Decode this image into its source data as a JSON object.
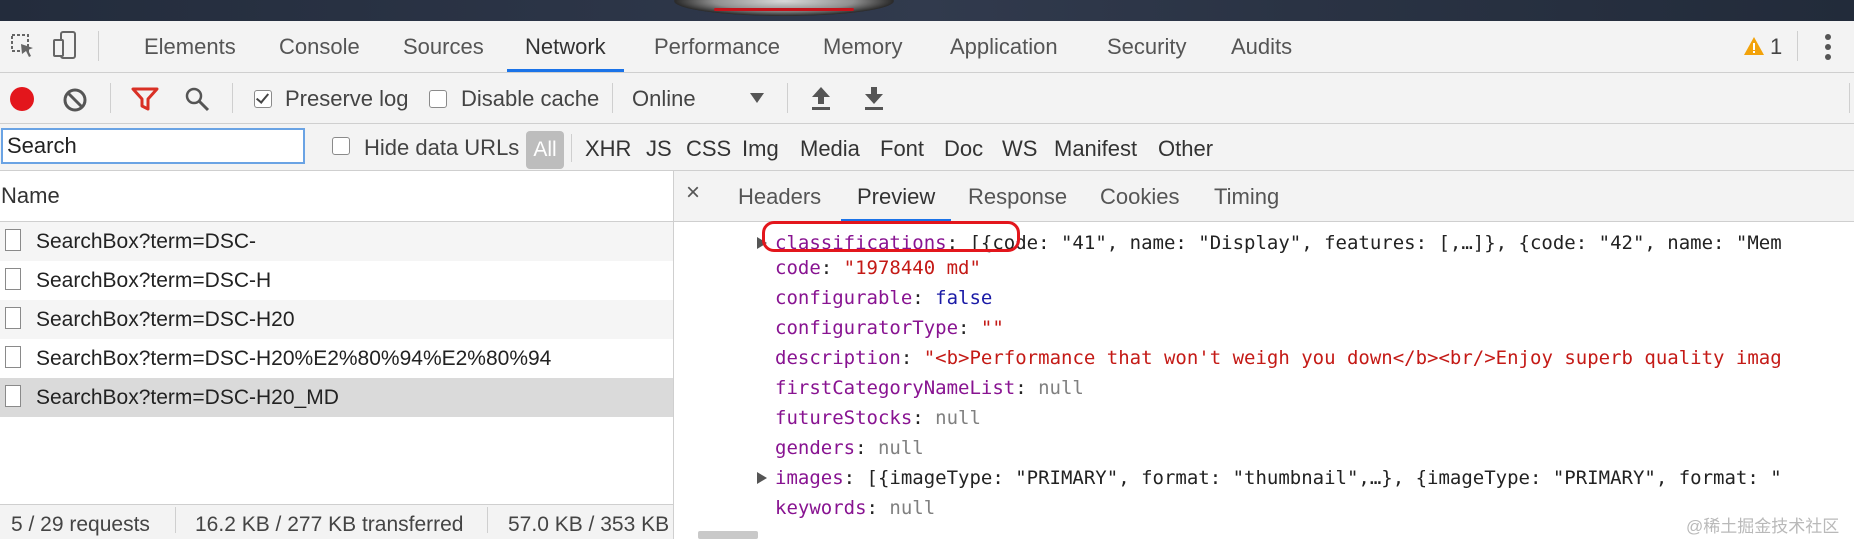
{
  "devtools": {
    "main_tabs": [
      "Elements",
      "Console",
      "Sources",
      "Network",
      "Performance",
      "Memory",
      "Application",
      "Security",
      "Audits"
    ],
    "warning_count": "1"
  },
  "toolbar": {
    "preserve_log": "Preserve log",
    "disable_cache": "Disable cache",
    "throttle": "Online"
  },
  "filter": {
    "search_value": "Search",
    "hide_data_urls": "Hide data URLs",
    "all": "All",
    "types": [
      "XHR",
      "JS",
      "CSS",
      "Img",
      "Media",
      "Font",
      "Doc",
      "WS",
      "Manifest",
      "Other"
    ]
  },
  "requests": {
    "header": "Name",
    "rows": [
      "SearchBox?term=DSC-",
      "SearchBox?term=DSC-H",
      "SearchBox?term=DSC-H20",
      "SearchBox?term=DSC-H20%E2%80%94%E2%80%94",
      "SearchBox?term=DSC-H20_MD"
    ],
    "status": {
      "requests": "5 / 29 requests",
      "transferred": "16.2 KB / 277 KB transferred",
      "resources": "57.0 KB / 353 KB"
    }
  },
  "detail": {
    "close": "×",
    "tabs": [
      "Headers",
      "Preview",
      "Response",
      "Cookies",
      "Timing"
    ],
    "preview": {
      "classifications_key": "classifications",
      "classifications_val": "[{code: \"41\", name: \"Display\", features: [,…]}, {code: \"42\", name: \"Mem",
      "code_key": "code",
      "code_val": "\"1978440 md\"",
      "configurable_key": "configurable",
      "configurable_val": "false",
      "configuratorType_key": "configuratorType",
      "configuratorType_val": "\"\"",
      "description_key": "description",
      "description_val": "\"<b>Performance that won't weigh you down</b><br/>Enjoy superb quality imag",
      "firstCategoryNameList_key": "firstCategoryNameList",
      "firstCategoryNameList_val": "null",
      "futureStocks_key": "futureStocks",
      "futureStocks_val": "null",
      "genders_key": "genders",
      "genders_val": "null",
      "images_key": "images",
      "images_val": "[{imageType: \"PRIMARY\", format: \"thumbnail\",…}, {imageType: \"PRIMARY\", format: \"",
      "keywords_key": "keywords",
      "keywords_val": "null"
    }
  },
  "watermark": "@稀土掘金技术社区",
  "colors": {
    "accent": "#1a73e8",
    "highlight": "#e3161c",
    "record": "#e3161c",
    "filter": "#d93025"
  }
}
